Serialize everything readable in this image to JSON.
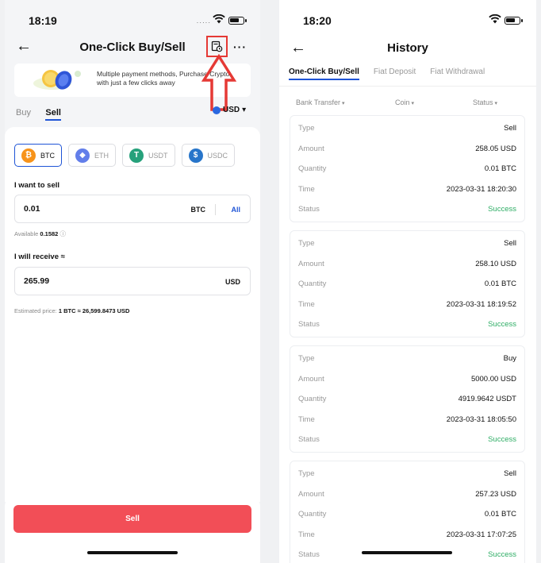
{
  "left": {
    "time": "18:19",
    "signal": "·····",
    "title": "One-Click Buy/Sell",
    "more": "···",
    "banner_text": "Multiple payment methods, Purchase Crypto with just a few clicks away",
    "tabs": [
      "Buy",
      "Sell"
    ],
    "currency": "USD",
    "coins": [
      {
        "label": "BTC",
        "symbol": "₿",
        "color": "#f7931a"
      },
      {
        "label": "ETH",
        "symbol": "◆",
        "color": "#627eea"
      },
      {
        "label": "USDT",
        "symbol": "T",
        "color": "#26a17b"
      },
      {
        "label": "USDC",
        "symbol": "$",
        "color": "#2775ca"
      }
    ],
    "sell_label": "I want to sell",
    "sell_value": "0.01",
    "sell_unit": "BTC",
    "all_label": "All",
    "available_label": "Available",
    "available_value": "0.1582",
    "receive_label": "I will receive ≈",
    "receive_value": "265.99",
    "receive_unit": "USD",
    "estimated_label": "Estimated price:",
    "estimated_value": "1 BTC ≈ 26,599.8473 USD",
    "sell_button": "Sell"
  },
  "right": {
    "time": "18:20",
    "title": "History",
    "tabs": [
      "One-Click Buy/Sell",
      "Fiat Deposit",
      "Fiat Withdrawal"
    ],
    "filters": [
      "Bank Transfer",
      "Coin",
      "Status"
    ],
    "field_labels": [
      "Type",
      "Amount",
      "Quantity",
      "Time",
      "Status"
    ],
    "records": [
      {
        "type": "Sell",
        "amount": "258.05 USD",
        "quantity": "0.01 BTC",
        "time": "2023-03-31 18:20:30",
        "status": "Success"
      },
      {
        "type": "Sell",
        "amount": "258.10 USD",
        "quantity": "0.01 BTC",
        "time": "2023-03-31 18:19:52",
        "status": "Success"
      },
      {
        "type": "Buy",
        "amount": "5000.00 USD",
        "quantity": "4919.9642 USDT",
        "time": "2023-03-31 18:05:50",
        "status": "Success"
      },
      {
        "type": "Sell",
        "amount": "257.23 USD",
        "quantity": "0.01 BTC",
        "time": "2023-03-31 17:07:25",
        "status": "Success"
      }
    ]
  },
  "colors": {
    "accent": "#1e54d6",
    "sell": "#f24e57",
    "success": "#2ead65",
    "highlight": "#e53935"
  }
}
